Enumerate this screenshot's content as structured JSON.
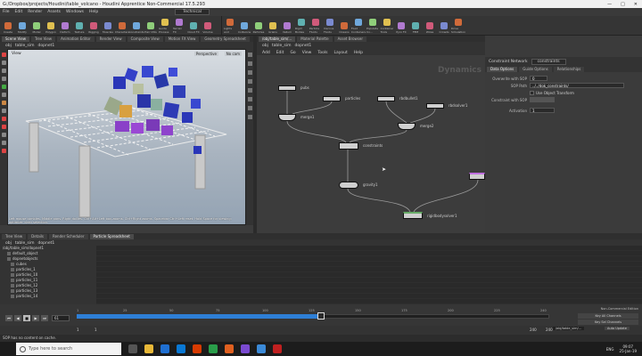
{
  "window": {
    "title": "G:/Dropbox/projects/Houdini/table_volcano - Houdini Apprentice Non-Commercial 17.5.293"
  },
  "menu": [
    "File",
    "Edit",
    "Render",
    "Assets",
    "Windows",
    "Help"
  ],
  "desktop_label": "Technical",
  "shelf_tabs_left": [
    "Create",
    "Modify",
    "Model",
    "Polygon",
    "Deform",
    "Texture",
    "Rigging",
    "Muscles",
    "Characters",
    "Constraints",
    "Hair Utils",
    "Guide Process",
    "Terrain FX",
    "Cloud FX",
    "Volume"
  ],
  "shelf_tabs_right": [
    "Lights and",
    "Collisions",
    "Particles",
    "Grains",
    "Vellum",
    "Rigid Bodies",
    "Particle Fluids",
    "Viscous Fluids",
    "Oceans",
    "Fluid Containers",
    "Populate Co...",
    "Container Tools",
    "Pyro FX",
    "FEM",
    "Wires",
    "Crowds",
    "Drive Simulation"
  ],
  "left_tabs": [
    "Scene View",
    "Tree View",
    "Animation Editor",
    "Render View",
    "Composite View",
    "Motion FX View",
    "Geometry Spreadsheet"
  ],
  "left_path": [
    "obj",
    "table_sim",
    "dopnet1"
  ],
  "viewport": {
    "label": "View",
    "camera": "Perspective",
    "display": "No cam",
    "status_text": "Left mouse tumbles. Middle pans. Right dollies. Ctrl+Alt+Left box-zooms. Ctrl+Right zooms. Spacebar Ctrl+Left reset. Hold Space for viewing: optimize: clear selection."
  },
  "net_tabs": [
    "/obj/table_sim/...",
    "Material Palette",
    "Asset Browser"
  ],
  "net_path": [
    "obj",
    "table_sim",
    "dopnet1"
  ],
  "net_menu": [
    "Add",
    "Edit",
    "Go",
    "View",
    "Tools",
    "Layout",
    "Help"
  ],
  "net_watermark": "Dynamics",
  "nodes": {
    "n1": "pubs",
    "n2": "particles",
    "n3": "rbdbullet1",
    "n4": "rbdsolver1",
    "n5": "merge1",
    "n6": "merge2",
    "n7": "constraints",
    "n8": "gravity1",
    "n9": "rigidbodysolver1"
  },
  "params": {
    "header_type": "Constraint Network",
    "header_name": "constraints",
    "tabs": [
      "Data Options",
      "Guide Options",
      "Relationships"
    ],
    "rows": [
      {
        "label": "Overwrite with SOP",
        "value": "0"
      },
      {
        "label": "SOP Path",
        "value": "../../dok_constraints/"
      },
      {
        "label": "Use Object Transform",
        "value": ""
      },
      {
        "label": "Constraint with SOP",
        "value": ""
      },
      {
        "label": "Activation",
        "value": "1"
      }
    ]
  },
  "bottom_tabs": [
    "Tree View",
    "Details",
    "Render Scheduler",
    "Particle Spreadsheet"
  ],
  "bottom_path": [
    "obj",
    "table_sim",
    "dopnet1"
  ],
  "tree_items": [
    "/obj/table_sim/dopnet1",
    "default_object",
    "dopnetobjects",
    "cubes",
    "particles_1",
    "particles_10",
    "particles_11",
    "particles_12",
    "particles_13",
    "particles_14"
  ],
  "timeline": {
    "current_frame": "61",
    "ticks": [
      "1",
      "25",
      "50",
      "75",
      "100",
      "125",
      "150",
      "175",
      "200",
      "225",
      "240"
    ],
    "start": "1",
    "end": "240",
    "start2": "1",
    "end2": "240",
    "fraction": 0.25,
    "status": "Non-Commercial Edition"
  },
  "buttons": {
    "auto_update": "Auto Update",
    "key_all": "Key All Channels",
    "key_sel": "Key Sel Channels"
  },
  "obj_field": "/obj/table_sim/...",
  "statusbar": "SOP has no content on cache.",
  "taskbar": {
    "search": "Type here to search",
    "time": "09:07",
    "date": "25-Jan-19",
    "lang": "ENG"
  }
}
